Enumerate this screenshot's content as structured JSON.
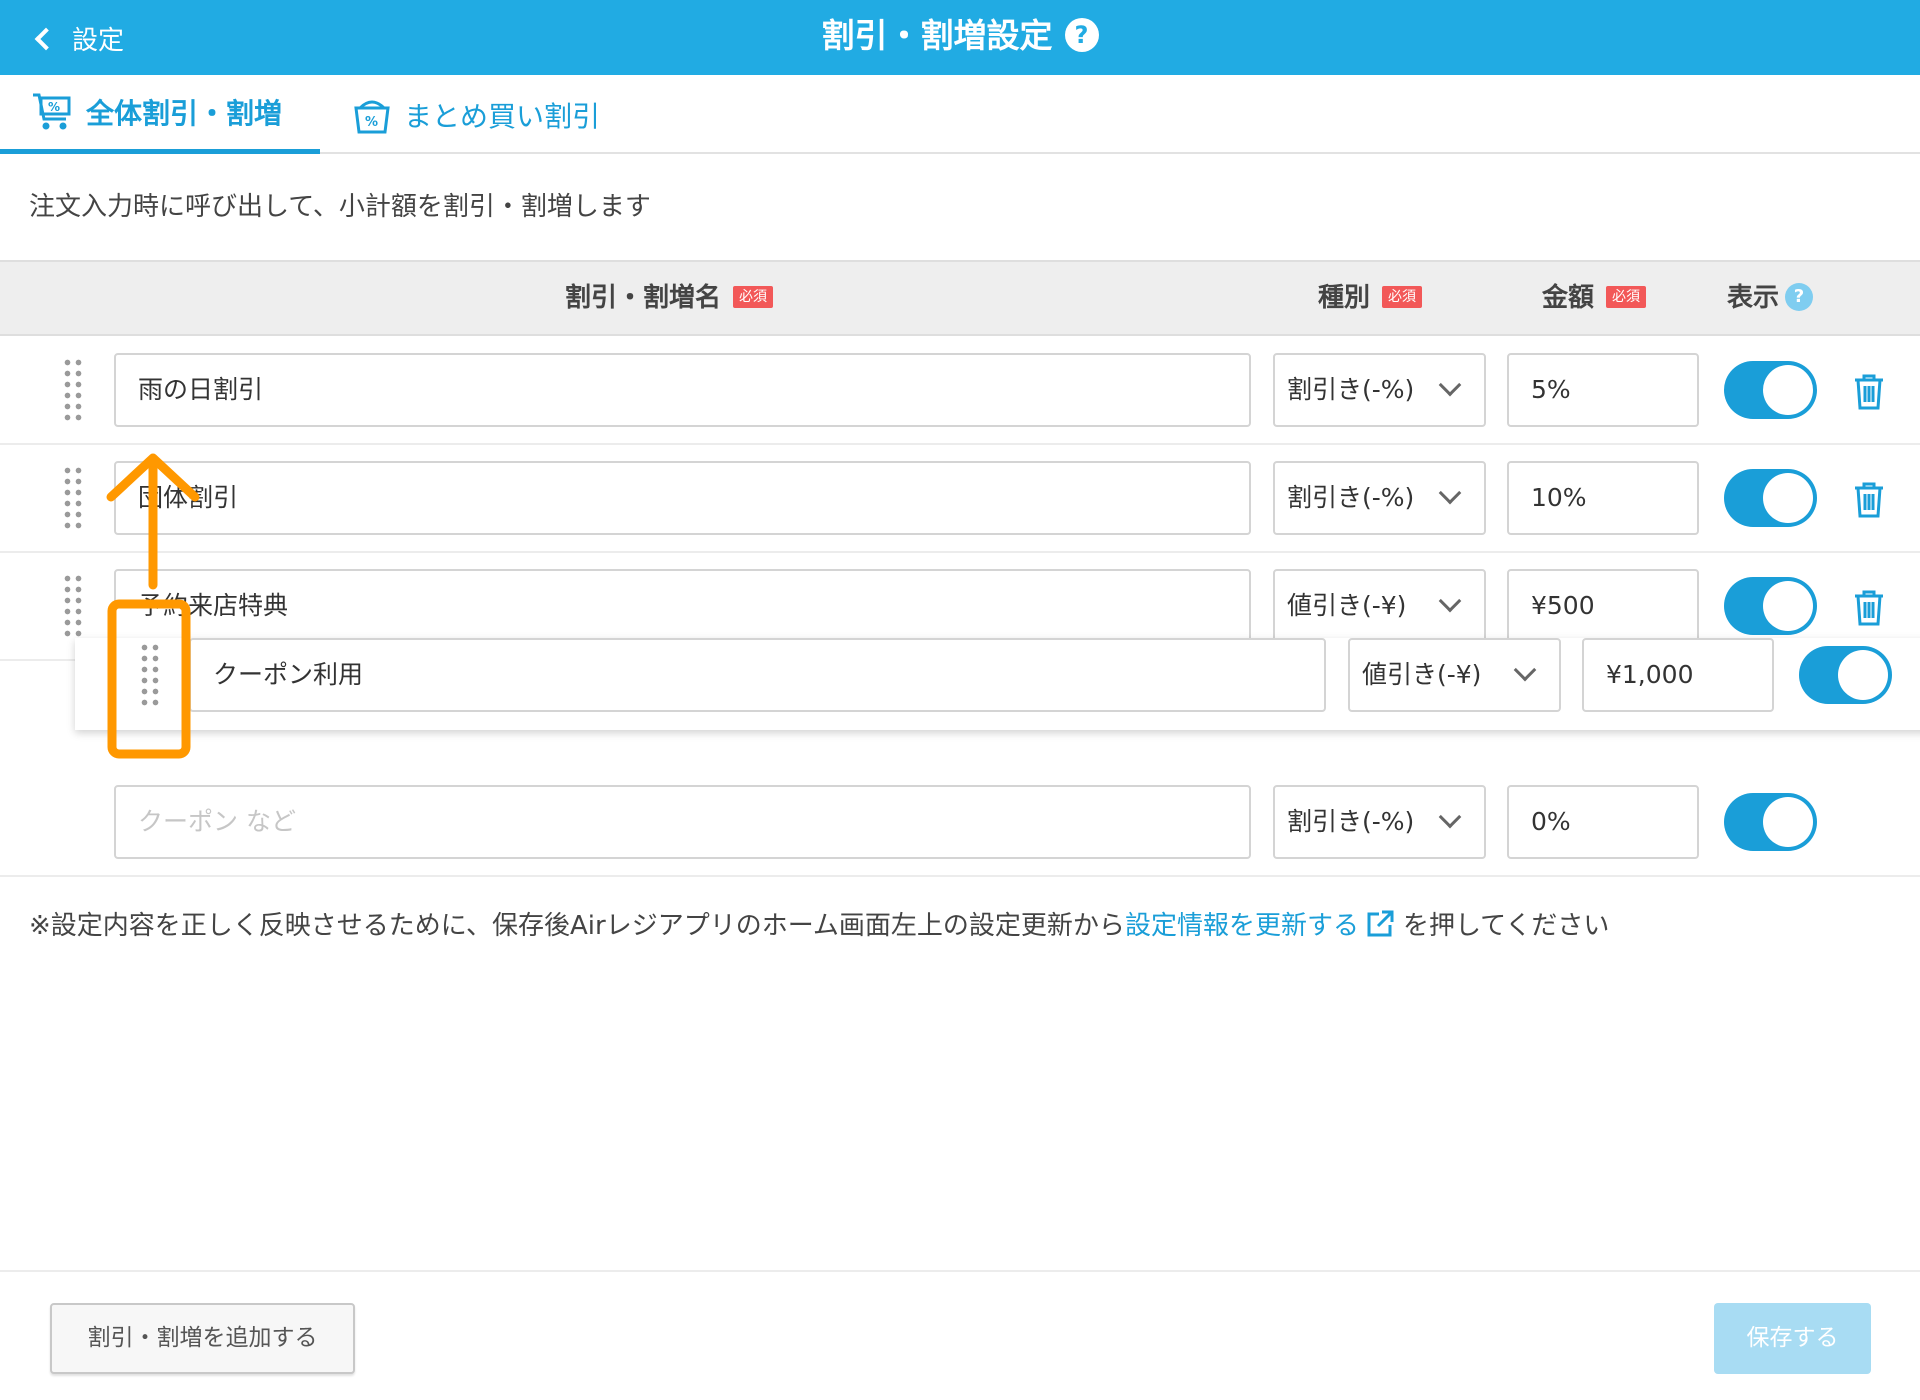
{
  "header": {
    "back_label": "設定",
    "title": "割引・割増設定",
    "help_glyph": "?"
  },
  "tabs": [
    {
      "label": "全体割引・割増",
      "icon": "cart-percent-icon",
      "active": true
    },
    {
      "label": "まとめ買い割引",
      "icon": "bag-percent-icon",
      "active": false
    }
  ],
  "description": "注文入力時に呼び出して、小計額を割引・割増します",
  "table": {
    "headers": {
      "name": "割引・割増名",
      "type": "種別",
      "amount": "金額",
      "display": "表示"
    },
    "required_badge": "必須",
    "display_help_glyph": "?",
    "rows": [
      {
        "name": "雨の日割引",
        "type": "割引き(-%)",
        "amount": "5%",
        "display": true
      },
      {
        "name": "団体割引",
        "type": "割引き(-%)",
        "amount": "10%",
        "display": true
      },
      {
        "name": "予約来店特典",
        "type": "値引き(-¥)",
        "amount": "¥500",
        "display": true
      }
    ],
    "dragging_row": {
      "name": "クーポン利用",
      "type": "値引き(-¥)",
      "amount": "¥1,000",
      "display": true
    },
    "new_row": {
      "name_placeholder": "クーポン など",
      "type": "割引き(-%)",
      "amount": "0%",
      "display": true
    }
  },
  "note": {
    "prefix": "※設定内容を正しく反映させるために、保存後Airレジアプリのホーム画面左上の設定更新から",
    "link": "設定情報を更新する",
    "suffix": "を押してください"
  },
  "footer": {
    "add_label": "割引・割増を追加する",
    "save_label": "保存する"
  },
  "colors": {
    "header": "#21abe3",
    "accent": "#1a9ed8",
    "required": "#f25858",
    "annotation": "#ff9800"
  }
}
